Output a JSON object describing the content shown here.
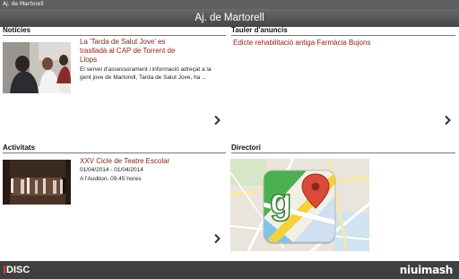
{
  "statusbar": {
    "title": "Aj. de Martorell"
  },
  "header": {
    "title": "Aj. de Martorell"
  },
  "noticies": {
    "heading": "Notícies",
    "item": {
      "title": "La 'Tarda de Salut Jove' es traslladà al CAP de Torrent de Llops",
      "description": "El servei d'assessorament i informació adreçat a la gent jove de Martorell, Tarda de Salut Jove, ha ..."
    }
  },
  "tauler": {
    "heading": "Tauler d'anuncis",
    "item": {
      "title": "Edicte rehabilitació antiga Farmàcia Bujons"
    }
  },
  "activitats": {
    "heading": "Activitats",
    "item": {
      "title": "XXV Cicle de Teatre Escolar",
      "dates": "01/04/2014 - 01/04/2014",
      "place": "A l'Auditori. 09.45 hores"
    }
  },
  "directori": {
    "heading": "Directori"
  },
  "footer": {
    "brand_left": "DISC",
    "brand_right": "niuimash"
  },
  "icons": {
    "more_arrow": "chevron-right-icon",
    "maps": "google-maps-icon"
  },
  "colors": {
    "title_link": "#8b1d18",
    "bar_dark": "#444444",
    "maps_pin": "#d94a3a"
  }
}
